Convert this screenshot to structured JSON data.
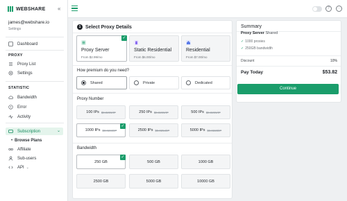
{
  "brand": {
    "name": "WEBSHARE",
    "accent": "#1a9d6b"
  },
  "account": {
    "email": "james@webshare.io",
    "sub": "Settings"
  },
  "sidebar": {
    "dashboard": "Dashboard",
    "proxy_section": "PROXY",
    "proxy_items": [
      "Proxy List",
      "Settings"
    ],
    "statistic_section": "STATISTIC",
    "statistic_items": [
      "Bandwidth",
      "Error",
      "Activity"
    ],
    "subscription": "Subscription",
    "subscription_children": [
      "Browse Plans",
      "Affiliate",
      "Sub-users",
      "API"
    ]
  },
  "main": {
    "step_number": "1",
    "step_title": "Select Proxy Details",
    "proxy_types": [
      {
        "title": "Proxy Server",
        "price": "From $2.99/mo",
        "selected": true,
        "icon_color": "#1a9d6b"
      },
      {
        "title": "Static Residential",
        "price": "From $6.00/mo",
        "selected": false,
        "icon_color": "#8a6cf0"
      },
      {
        "title": "Residential",
        "price": "From $7.00/mo",
        "selected": false,
        "icon_color": "#5b7be8"
      }
    ],
    "premium_question": "How premium do you need?",
    "premium_options": [
      {
        "label": "Shared",
        "selected": true
      },
      {
        "label": "Private",
        "selected": false
      },
      {
        "label": "Dedicated",
        "selected": false
      }
    ],
    "proxy_number_label": "Proxy Number",
    "proxy_numbers": [
      {
        "main": "100 IPs",
        "sub": "$0.0299/IP",
        "selected": false
      },
      {
        "main": "250 IPs",
        "sub": "$0.0299/IP",
        "selected": false
      },
      {
        "main": "500 IPs",
        "sub": "$0.0299/IP",
        "selected": false
      },
      {
        "main": "1000 IPs",
        "sub": "$0.0269/IP",
        "selected": true
      },
      {
        "main": "2500 IPs",
        "sub": "$0.0254/IP",
        "selected": false
      },
      {
        "main": "5000 IPs",
        "sub": "$0.0228/IP",
        "selected": false
      }
    ],
    "bandwidth_label": "Bandwidth",
    "bandwidths": [
      {
        "main": "250 GB",
        "selected": true
      },
      {
        "main": "500 GB",
        "selected": false
      },
      {
        "main": "1000 GB",
        "selected": false
      },
      {
        "main": "2500 GB",
        "selected": false
      },
      {
        "main": "5000 GB",
        "selected": false
      },
      {
        "main": "10000 GB",
        "selected": false
      }
    ]
  },
  "summary": {
    "title": "Summary",
    "product": "Proxy Server",
    "product_tier": "Shared",
    "features": [
      "1000 proxies",
      "250GB bandwidth"
    ],
    "discount_label": "Discount",
    "discount_value": "10%",
    "pay_label": "Pay Today",
    "pay_value": "$53.82",
    "continue_label": "Continue"
  }
}
